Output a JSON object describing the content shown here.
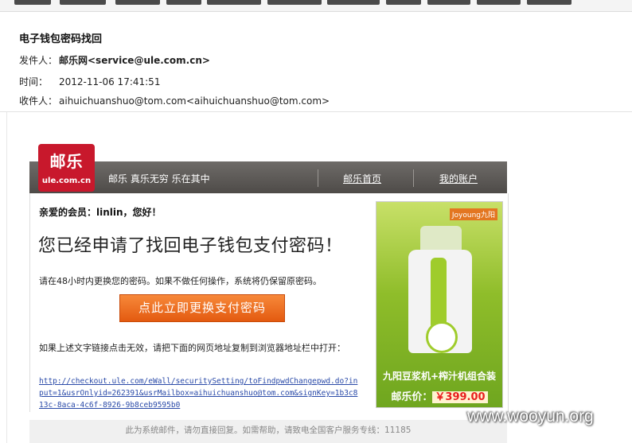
{
  "email": {
    "subject": "电子钱包密码找回",
    "sender_label": "发件人：",
    "sender": "邮乐网<service@ule.com.cn>",
    "time_label": "时间：",
    "time": "2012-11-06 17:41:51",
    "recipient_label": "收件人：",
    "recipient": "aihuichuanshuo@tom.com<aihuichuanshuo@tom.com>"
  },
  "body": {
    "logo_main": "邮乐",
    "logo_sub": "ule.com.cn",
    "slogan": "邮乐  真乐无穷  乐在其中",
    "nav_home": "邮乐首页",
    "nav_account": "我的账户",
    "greeting": "亲爱的会员：linlin，您好！",
    "headline": "您已经申请了找回电子钱包支付密码！",
    "notice": "请在48小时内更换您的密码。如果不做任何操作，系统将仍保留原密码。",
    "cta_label": "点此立即更换支付密码",
    "fallback_text": "如果上述文字链接点击无效，请把下面的网页地址复制到浏览器地址栏中打开：",
    "url": "http://checkout.ule.com/eWall/securitySetting/toFindpwdChangepwd.do?input=1&usrOnlyid=262391&usrMailbox=aihuichuanshuo@tom.com&signKey=1b3c813c-8aca-4c6f-8926-9b8ceb9595b0",
    "footer": "此为系统邮件，请勿直接回复。如需帮助，请致电全国客户服务专线：11185"
  },
  "ad": {
    "brand": "Joyoung九阳",
    "product_name": "九阳豆浆机+榨汁机组合装",
    "price_label": "邮乐价：",
    "price": "￥399.00"
  },
  "watermark": "www.wooyun.org",
  "colors": {
    "brand_red": "#c8182c",
    "cta_orange": "#f06a1f",
    "nav_gray": "#5e5b58",
    "link_blue": "#2a4aa8"
  }
}
